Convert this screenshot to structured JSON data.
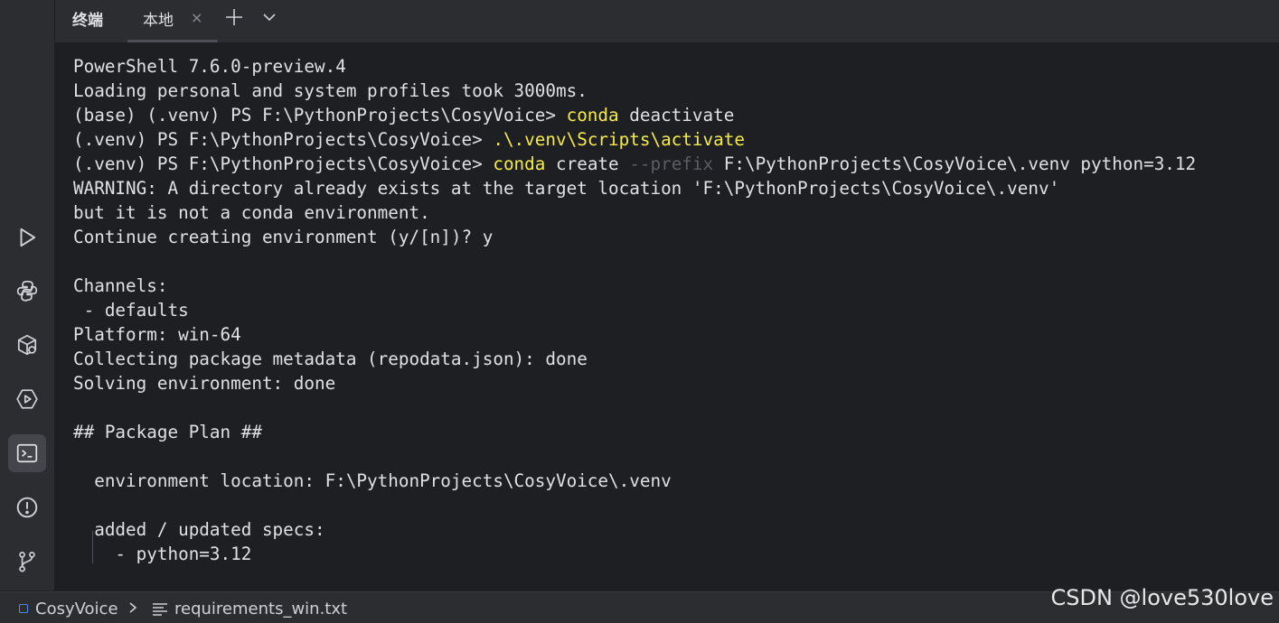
{
  "header": {
    "panel_title": "终端",
    "tab_label": "本地",
    "tab_close": "×"
  },
  "terminal": {
    "lines": [
      {
        "segments": [
          {
            "text": "PowerShell 7.6.0-preview.4",
            "style": "normal"
          }
        ]
      },
      {
        "segments": [
          {
            "text": "Loading personal and system profiles took 3000ms.",
            "style": "normal"
          }
        ]
      },
      {
        "segments": [
          {
            "text": "(base) (.venv) PS F:\\PythonProjects\\CosyVoice> ",
            "style": "normal"
          },
          {
            "text": "conda",
            "style": "kw"
          },
          {
            "text": " deactivate",
            "style": "normal"
          }
        ]
      },
      {
        "segments": [
          {
            "text": "(.venv) PS F:\\PythonProjects\\CosyVoice> ",
            "style": "normal"
          },
          {
            "text": ".\\.venv\\Scripts\\activate",
            "style": "kw"
          }
        ]
      },
      {
        "segments": [
          {
            "text": "(.venv) PS F:\\PythonProjects\\CosyVoice> ",
            "style": "normal"
          },
          {
            "text": "conda",
            "style": "kw"
          },
          {
            "text": " create ",
            "style": "normal"
          },
          {
            "text": "--prefix",
            "style": "dim"
          },
          {
            "text": " F:\\PythonProjects\\CosyVoice\\.venv python=3.12",
            "style": "normal"
          }
        ]
      },
      {
        "segments": [
          {
            "text": "WARNING: A directory already exists at the target location 'F:\\PythonProjects\\CosyVoice\\.venv'",
            "style": "normal"
          }
        ]
      },
      {
        "segments": [
          {
            "text": "but it is not a conda environment.",
            "style": "normal"
          }
        ]
      },
      {
        "segments": [
          {
            "text": "Continue creating environment (y/[n])? y",
            "style": "normal"
          }
        ]
      },
      {
        "segments": [
          {
            "text": "",
            "style": "normal"
          }
        ]
      },
      {
        "segments": [
          {
            "text": "Channels:",
            "style": "normal"
          }
        ]
      },
      {
        "segments": [
          {
            "text": " - defaults",
            "style": "normal"
          }
        ]
      },
      {
        "segments": [
          {
            "text": "Platform: win-64",
            "style": "normal"
          }
        ]
      },
      {
        "segments": [
          {
            "text": "Collecting package metadata (repodata.json): done",
            "style": "normal"
          }
        ]
      },
      {
        "segments": [
          {
            "text": "Solving environment: done",
            "style": "normal"
          }
        ]
      },
      {
        "segments": [
          {
            "text": "",
            "style": "normal"
          }
        ]
      },
      {
        "segments": [
          {
            "text": "## Package Plan ##",
            "style": "normal"
          }
        ]
      },
      {
        "segments": [
          {
            "text": "",
            "style": "normal"
          }
        ]
      },
      {
        "segments": [
          {
            "text": "  environment location: F:\\PythonProjects\\CosyVoice\\.venv",
            "style": "normal"
          }
        ]
      },
      {
        "segments": [
          {
            "text": "",
            "style": "normal"
          }
        ]
      },
      {
        "segments": [
          {
            "text": "  added / updated specs:",
            "style": "normal"
          }
        ]
      },
      {
        "segments": [
          {
            "text": "    - python=3.12",
            "style": "normal"
          }
        ]
      }
    ],
    "colors": {
      "text": "#dfe1e5",
      "keyword": "#f6ea48",
      "dim_flag": "#5a5d63"
    }
  },
  "toolstrip": [
    {
      "icon": "run-icon"
    },
    {
      "icon": "python-console-icon"
    },
    {
      "icon": "python-packages-icon"
    },
    {
      "icon": "services-icon"
    },
    {
      "icon": "terminal-icon",
      "active": true
    },
    {
      "icon": "problems-icon"
    },
    {
      "icon": "git-icon"
    }
  ],
  "statusbar": {
    "project": "CosyVoice",
    "file": "requirements_win.txt"
  },
  "watermark": "CSDN @love530love"
}
